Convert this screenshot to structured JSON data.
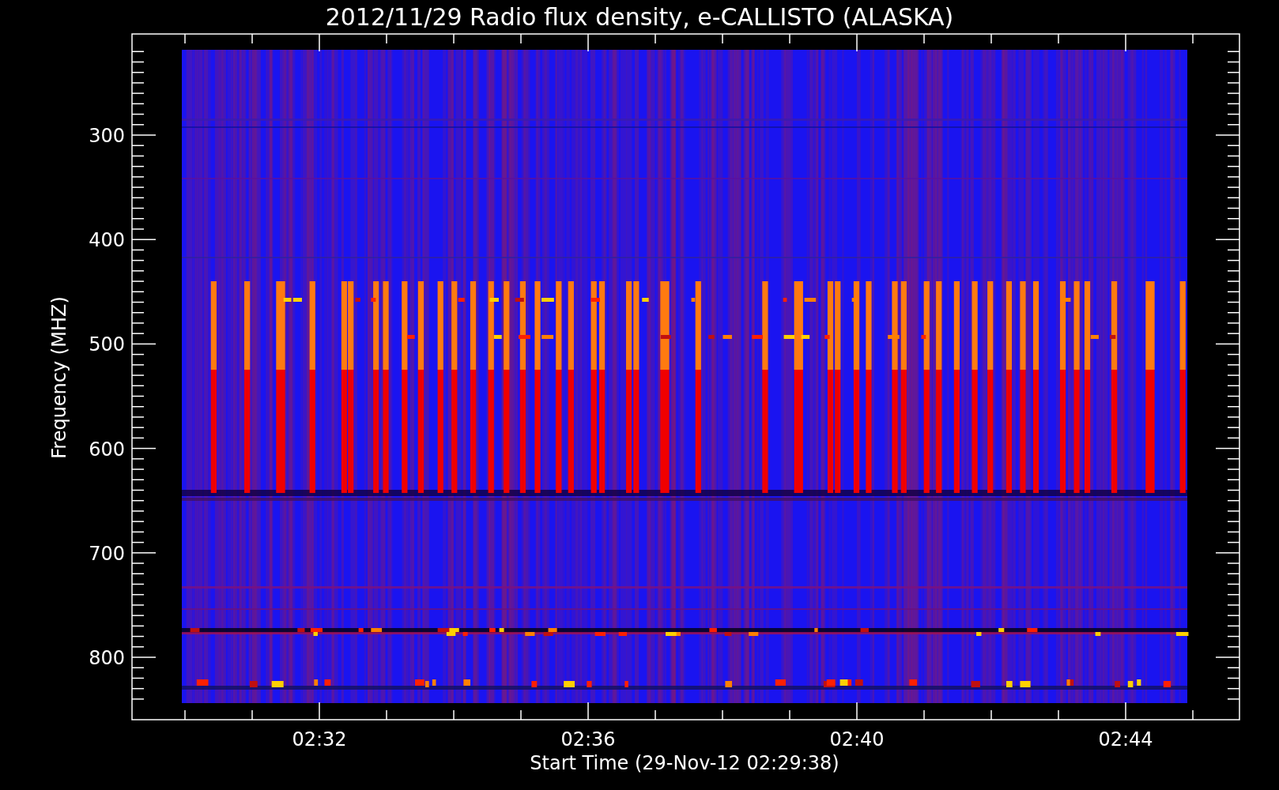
{
  "plot": {
    "title": "2012/11/29  Radio flux density, e-CALLISTO (ALASKA)",
    "ylabel": "Frequency (MHZ)",
    "xlabel": "Start Time (29-Nov-12 02:29:38)",
    "yticks": [
      "300",
      "400",
      "500",
      "600",
      "700",
      "800"
    ],
    "xticks": [
      "02:32",
      "02:36",
      "02:40",
      "02:44"
    ]
  }
}
